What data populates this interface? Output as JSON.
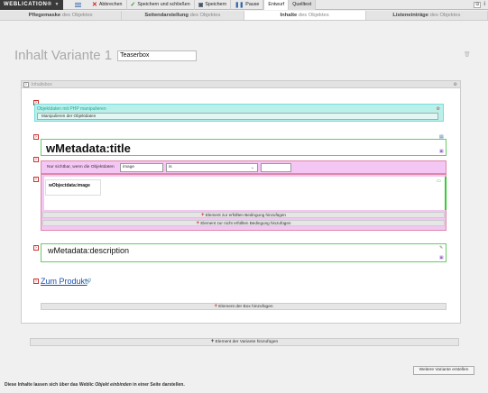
{
  "app": {
    "brand": "WEBLICATION®"
  },
  "toolbar": {
    "cancel": "Abbrechen",
    "save_close": "Speichern und schließen",
    "save": "Speichern",
    "pause": "Pause",
    "draft": "Entwurf",
    "source": "Quelltext"
  },
  "tabs": [
    {
      "bold": "Pflegemaske",
      "rest": " des Objektes"
    },
    {
      "bold": "Seitendarstellung",
      "rest": " des Objektes"
    },
    {
      "bold": "Inhalte",
      "rest": " des Objektes"
    },
    {
      "bold": "Listeneinträge",
      "rest": " des Objektes"
    }
  ],
  "heading": {
    "title": "Inhalt Variante 1",
    "name_value": "Teaserbox"
  },
  "box": {
    "label": "Inhaltsbox"
  },
  "php": {
    "title": "Objektdaten mit PHP manipulieren",
    "desc": "Manipulieren der Objektdaten"
  },
  "element_title": "wMetadata:title",
  "condition": {
    "label": "Nur sichtbar, wenn die Objektdaten",
    "field_value": "image",
    "operator": "is",
    "image_element": "wObjectdata:image",
    "add_fulfilled": "Element zur erfüllten Bedingung hinzufügen",
    "add_unfulfilled": "Element zur nicht erfüllten Bedingung hinzufügen"
  },
  "element_description": "wMetadata:description",
  "link_text": "Zum Produkt",
  "add_box_element": "Element der Box hinzufügen",
  "add_variant_element": "Element der Variante hinzufügen",
  "more_variant": "Weitere Variante erstellen",
  "footer": {
    "pre": "Diese Inhalte lassen sich über das Weblic ",
    "italic": "Objekt einbinden",
    "post": " in einer Seite darstellen."
  }
}
